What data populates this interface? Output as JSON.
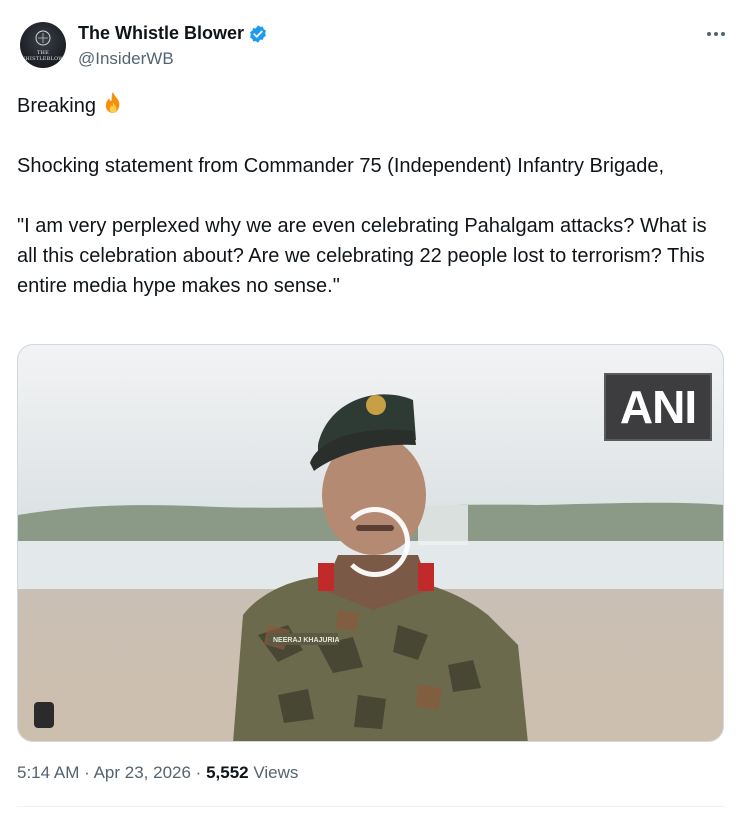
{
  "author": {
    "name": "The Whistle Blower",
    "handle": "@InsiderWB",
    "verified": true,
    "avatar_text": "THE WHISTLEBLOWER"
  },
  "tweet": {
    "line1": "Breaking",
    "line1_emoji": "fire-emoji",
    "paragraph2": "Shocking statement from Commander 75 (Independent) Infantry Brigade,",
    "paragraph3": "\"I am very perplexed why we are even celebrating Pahalgam attacks? What is all this celebration about? Are we celebrating 22 people lost to terrorism? This entire media hype makes no sense.\""
  },
  "media": {
    "watermark": "ANI",
    "name_tag": "NEERAJ KHAJURIA"
  },
  "meta": {
    "time": "5:14 AM",
    "separator": "·",
    "date": "Apr 23, 2026",
    "views_count": "5,552",
    "views_label": "Views"
  },
  "colors": {
    "verified_badge": "#1d9bf0",
    "secondary_text": "#536471",
    "primary_text": "#0f1419"
  }
}
